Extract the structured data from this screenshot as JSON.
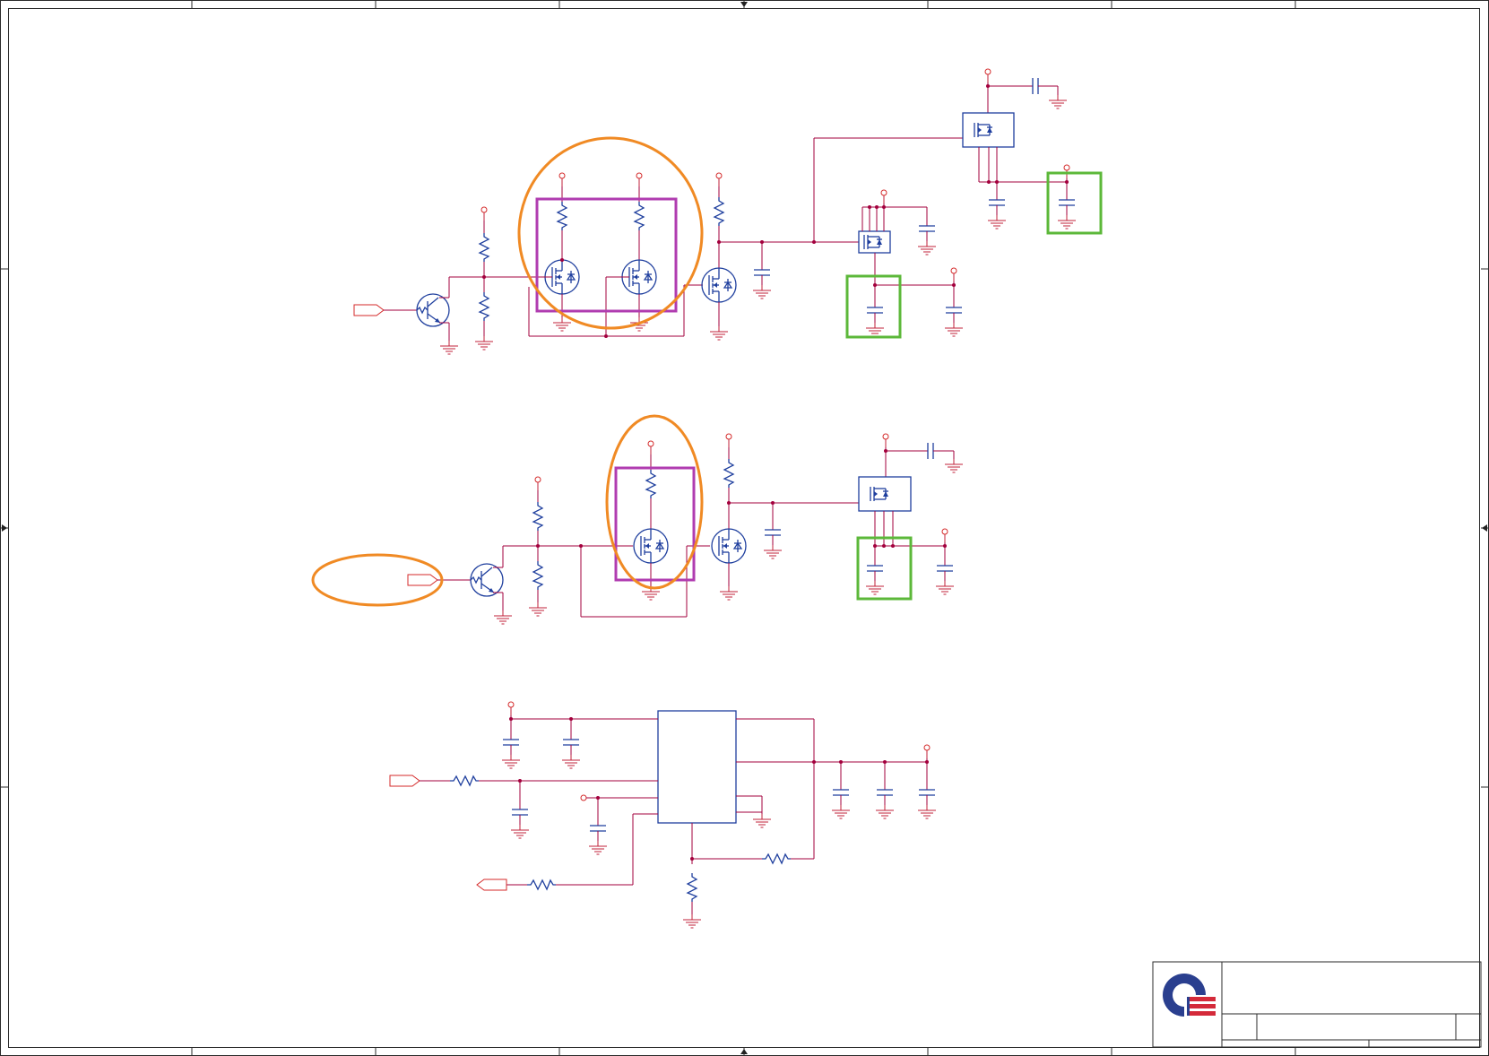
{
  "colors": {
    "wire": "#a3003d",
    "component": "#1f3f9e",
    "power_and_ground": "#d42a2a",
    "highlight_box": "#b03cb0",
    "highlight_ellipse": "#f08a24",
    "highlight_square": "#5cb83a",
    "logo_blue": "#2a3f8f",
    "logo_red": "#d42a3a"
  },
  "title_block": {
    "logo": "company-logo",
    "title": "",
    "size": "",
    "document_number": "",
    "revision": ""
  }
}
